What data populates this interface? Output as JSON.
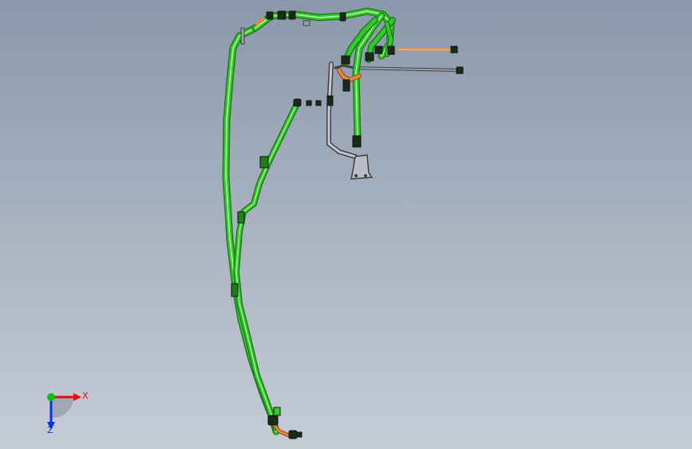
{
  "viewport": {
    "background_top": "#8b98ab",
    "background_bottom": "#c6ccd6"
  },
  "model": {
    "hose_color": "#35c82e",
    "hose_highlight": "#b5f7a8",
    "hose_shadow": "#1f7d1a",
    "fitting_color": "#e08a3a",
    "pipe_color": "#9aa0a6",
    "pipe_dark": "#3d4046",
    "bracket_color": "#b9bec4"
  },
  "triad": {
    "x_label": "X",
    "z_label": "Z",
    "x_color": "#e01010",
    "y_color": "#10c010",
    "z_color": "#1030e0"
  }
}
